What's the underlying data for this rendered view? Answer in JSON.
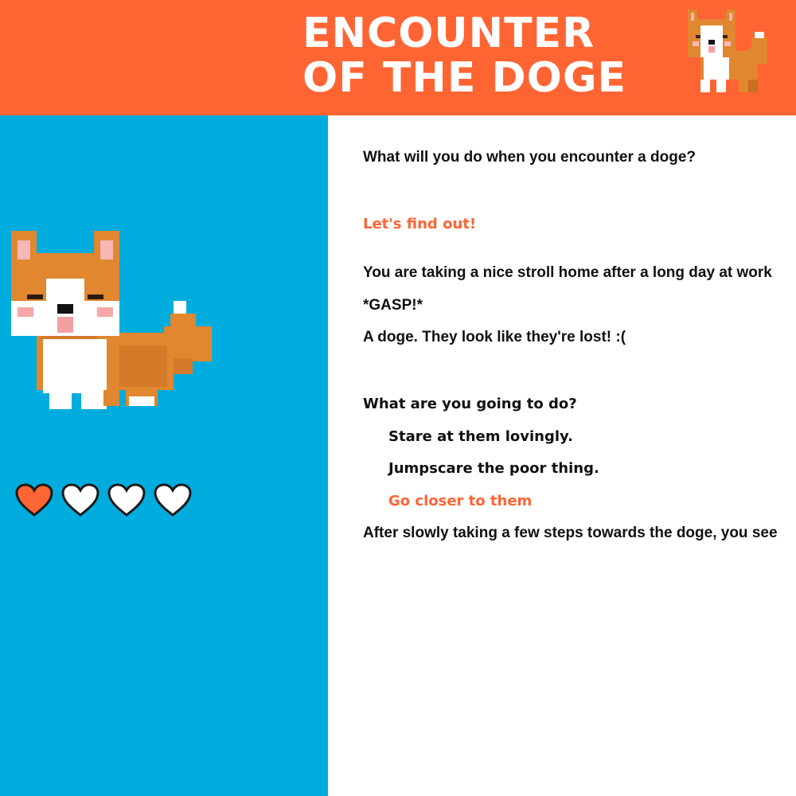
{
  "header": {
    "title_line1": "ENCOUNTER",
    "title_line2": "OF THE DOGE",
    "background_color": "#ff6433",
    "logo_icon": "pixel-corgi-icon"
  },
  "sidebar": {
    "background_color": "#00acde",
    "character_icon": "pixel-corgi-icon",
    "hearts": {
      "total": 4,
      "filled": 1,
      "filled_color": "#ff6433",
      "empty_color": "#ffffff"
    }
  },
  "story": {
    "intro_question": "What will you do when you encounter a doge?",
    "start_link": "Let's find out!",
    "paragraph1": "You are taking a nice stroll home after a long day at work",
    "paragraph2": "*GASP!*",
    "paragraph3": "A doge. They look like they're lost! :(",
    "prompt": "What are you going to do?",
    "choices": [
      {
        "label": "Stare at them lovingly.",
        "selected": false
      },
      {
        "label": "Jumpscare the poor thing.",
        "selected": false
      },
      {
        "label": "Go closer to them",
        "selected": true
      }
    ],
    "result": "After slowly taking a few steps towards the doge, you see"
  },
  "colors": {
    "accent": "#ff6433",
    "text": "#111111"
  }
}
